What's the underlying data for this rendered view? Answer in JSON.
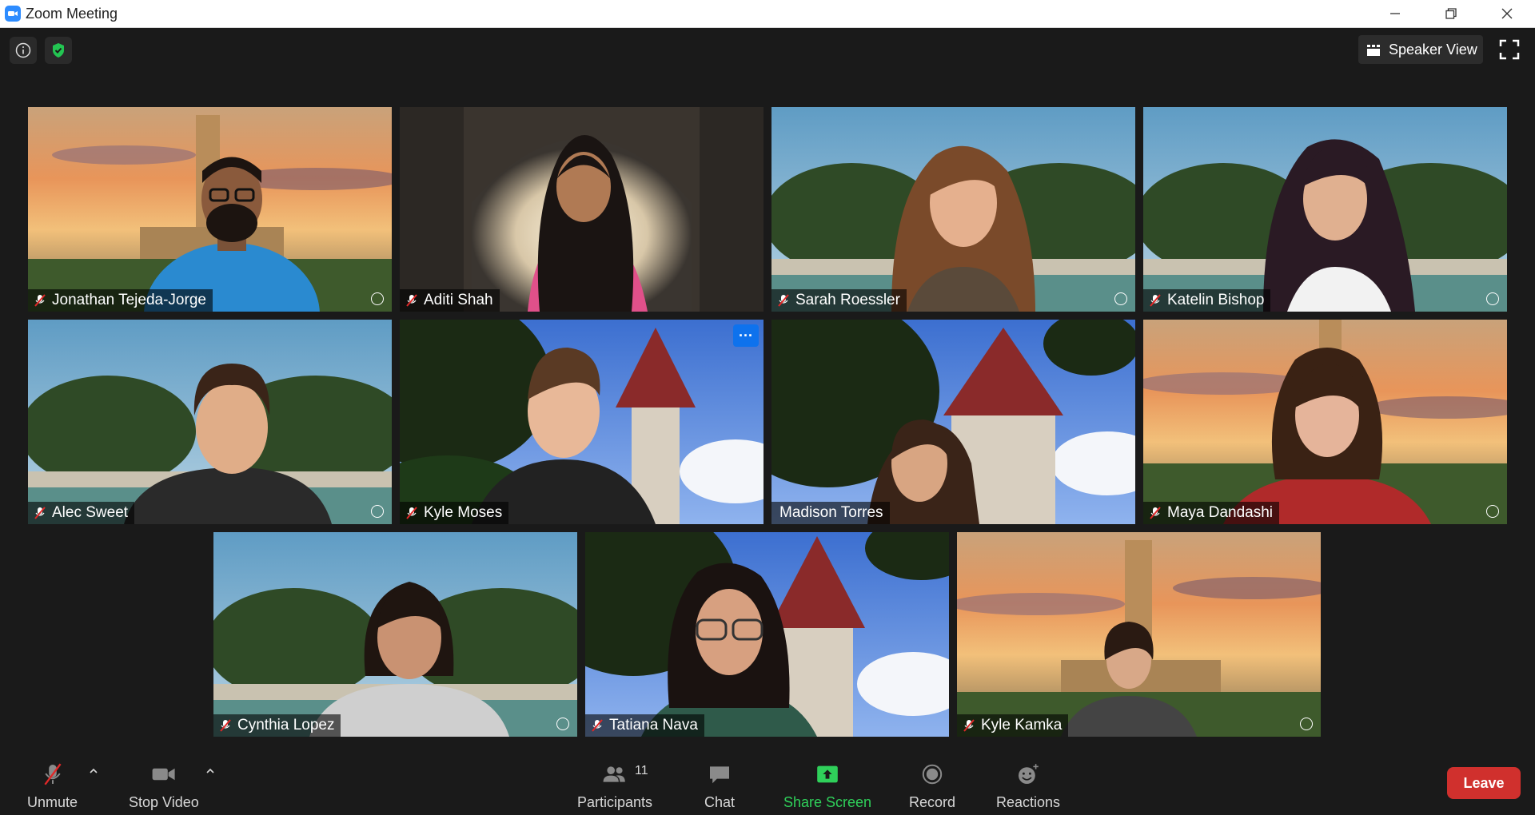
{
  "window": {
    "title": "Zoom Meeting"
  },
  "top_bar": {
    "speaker_view_label": "Speaker View"
  },
  "participants": [
    {
      "name": "Jonathan Tejeda-Jorge",
      "muted": true,
      "background": "tower-sunset"
    },
    {
      "name": "Aditi Shah",
      "muted": true,
      "background": "arch"
    },
    {
      "name": "Sarah Roessler",
      "muted": true,
      "background": "fountain"
    },
    {
      "name": "Katelin Bishop",
      "muted": true,
      "background": "fountain"
    },
    {
      "name": "Alec Sweet",
      "muted": true,
      "background": "fountain"
    },
    {
      "name": "Kyle Moses",
      "muted": true,
      "background": "steeple"
    },
    {
      "name": "Madison Torres",
      "muted": false,
      "background": "steeple",
      "active_speaker": true
    },
    {
      "name": "Maya Dandashi",
      "muted": true,
      "background": "tower-sunset"
    },
    {
      "name": "Cynthia Lopez",
      "muted": true,
      "background": "fountain"
    },
    {
      "name": "Tatiana Nava",
      "muted": true,
      "background": "steeple"
    },
    {
      "name": "Kyle Kamka",
      "muted": true,
      "background": "tower-sunset"
    }
  ],
  "tile_menu_label": "···",
  "toolbar": {
    "unmute_label": "Unmute",
    "stop_video_label": "Stop Video",
    "participants_label": "Participants",
    "participants_count": "11",
    "chat_label": "Chat",
    "share_screen_label": "Share Screen",
    "record_label": "Record",
    "reactions_label": "Reactions",
    "leave_label": "Leave"
  },
  "colors": {
    "accent_blue": "#2d8cff",
    "share_green": "#2fd05a",
    "leave_red": "#d0302d",
    "active_speaker_border": "#e5f07b"
  }
}
